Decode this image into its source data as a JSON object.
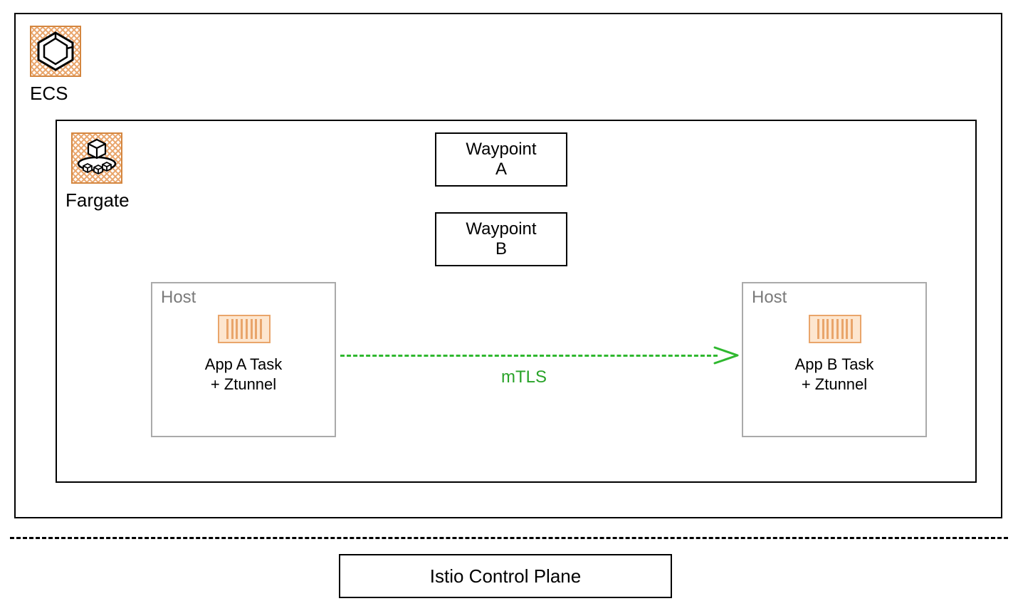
{
  "ecs": {
    "label": "ECS"
  },
  "fargate": {
    "label": "Fargate"
  },
  "waypoints": {
    "a": "Waypoint\nA",
    "b": "Waypoint\nB"
  },
  "hosts": {
    "left": {
      "title": "Host",
      "task": "App A Task\n+ Ztunnel"
    },
    "right": {
      "title": "Host",
      "task": "App B Task\n+ Ztunnel"
    }
  },
  "connection": {
    "label": "mTLS"
  },
  "control_plane": {
    "label": "Istio Control Plane"
  }
}
